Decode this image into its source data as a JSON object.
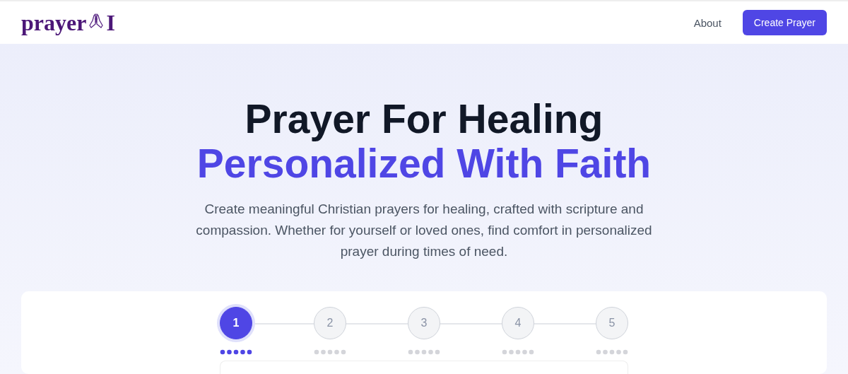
{
  "header": {
    "logo": {
      "text_before": "prayer",
      "text_after": "I"
    },
    "nav": [
      {
        "label": "About"
      }
    ],
    "cta": {
      "label": "Create Prayer"
    }
  },
  "hero": {
    "title": "Prayer For Healing",
    "subtitle": "Personalized With Faith",
    "description": "Create meaningful Christian prayers for healing, crafted with scripture and compassion. Whether for yourself or loved ones, find comfort in personalized prayer during times of need."
  },
  "stepper": {
    "steps": [
      {
        "label": "1",
        "selected": true
      },
      {
        "label": "2",
        "selected": false
      },
      {
        "label": "3",
        "selected": false
      },
      {
        "label": "4",
        "selected": false
      },
      {
        "label": "5",
        "selected": false
      }
    ]
  }
}
